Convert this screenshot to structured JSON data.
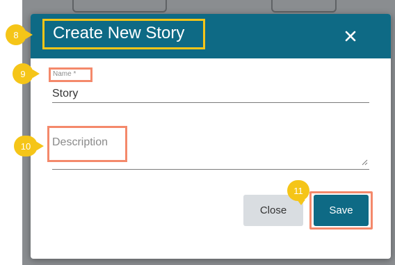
{
  "dialog": {
    "title": "Create New Story",
    "name_label": "Name *",
    "name_value": "Story",
    "description_placeholder": "Description",
    "close_label": "Close",
    "save_label": "Save"
  },
  "annotations": {
    "title_marker": "8",
    "name_marker": "9",
    "description_marker": "10",
    "save_marker": "11"
  },
  "colors": {
    "header": "#0e6a85",
    "marker": "#f5c518",
    "highlight_title": "#f5c518",
    "highlight_fields": "#f4896b",
    "close_button": "#d9dde1",
    "save_button": "#0e6a85"
  },
  "icons": {
    "close": "close-icon",
    "resize": "resize-handle-icon"
  }
}
